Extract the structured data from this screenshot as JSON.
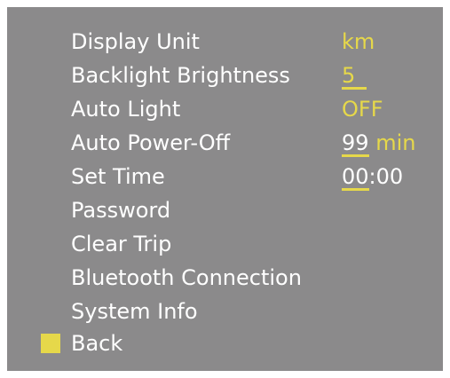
{
  "menu": {
    "items": [
      {
        "label": "Display Unit"
      },
      {
        "label": "Backlight Brightness"
      },
      {
        "label": "Auto Light"
      },
      {
        "label": "Auto Power-Off"
      },
      {
        "label": "Set Time"
      },
      {
        "label": "Password"
      },
      {
        "label": "Clear Trip"
      },
      {
        "label": "Bluetooth Connection"
      },
      {
        "label": "System Info"
      },
      {
        "label": "Back"
      }
    ],
    "selected_index": 9
  },
  "values": {
    "display_unit": "km",
    "backlight_brightness": "5",
    "auto_light": "OFF",
    "auto_power_off_number": "99",
    "auto_power_off_unit": "min",
    "time_hours": "00",
    "time_separator": ":",
    "time_minutes": "00"
  },
  "colors": {
    "screen_background": "#8b8a8b",
    "text": "#ffffff",
    "accent": "#e6d84a"
  }
}
